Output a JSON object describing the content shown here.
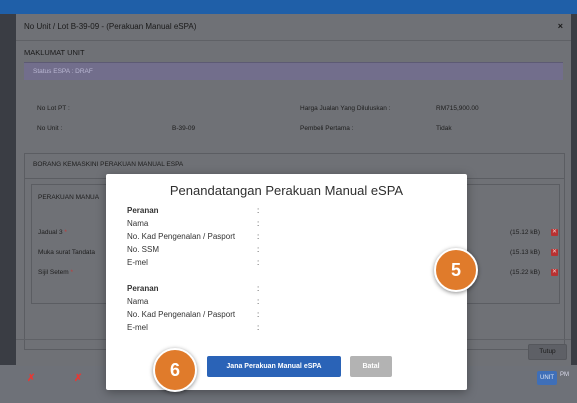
{
  "outer_modal": {
    "title": "No Unit / Lot B-39-09 - (Perakuan Manual eSPA)",
    "close_label": "×",
    "section_title": "MAKLUMAT UNIT",
    "status_text": "Status ESPA : DRAF",
    "fields": {
      "no_lot_pt_label": "No Lot PT :",
      "no_unit_label": "No Unit :",
      "no_unit_value": "B-39-09",
      "harga_label": "Harga Jualan Yang Diluluskan :",
      "harga_value": "RM715,900.00",
      "pembeli_label": "Pembeli Pertama :",
      "pembeli_value": "Tidak"
    },
    "borang_title": "BORANG KEMASKINI PERAKUAN MANUAL ESPA",
    "perakuan_title": "PERAKUAN MANUA",
    "documents": [
      {
        "label": "Jadual 3",
        "required": "*",
        "size": "(15.12 kB)"
      },
      {
        "label": "Muka surat Tandata",
        "required": "",
        "size": "(15.13 kB)"
      },
      {
        "label": "Sijil Setem",
        "required": "*",
        "size": "(15.22 kB)"
      }
    ],
    "tutup_label": "Tutup"
  },
  "dialog": {
    "title": "Penandatangan Perakuan Manual eSPA",
    "signatories": [
      {
        "peranan": "Peranan",
        "nama": "Nama",
        "ic": "No. Kad Pengenalan / Pasport",
        "ssm": "No. SSM",
        "email": "E-mel"
      },
      {
        "peranan": "Peranan",
        "nama": "Nama",
        "ic": "No. Kad Pengenalan / Pasport",
        "email": "E-mel"
      }
    ],
    "colon": ":",
    "jana_label": "Jana Perakuan Manual eSPA",
    "batal_label": "Batal"
  },
  "background": {
    "unit_label": "UNIT",
    "pm_label": "PM"
  },
  "steps": {
    "five": "5",
    "six": "6"
  },
  "colors": {
    "primary": "#2a63b7",
    "step": "#e07b2b",
    "danger": "#b83232"
  }
}
